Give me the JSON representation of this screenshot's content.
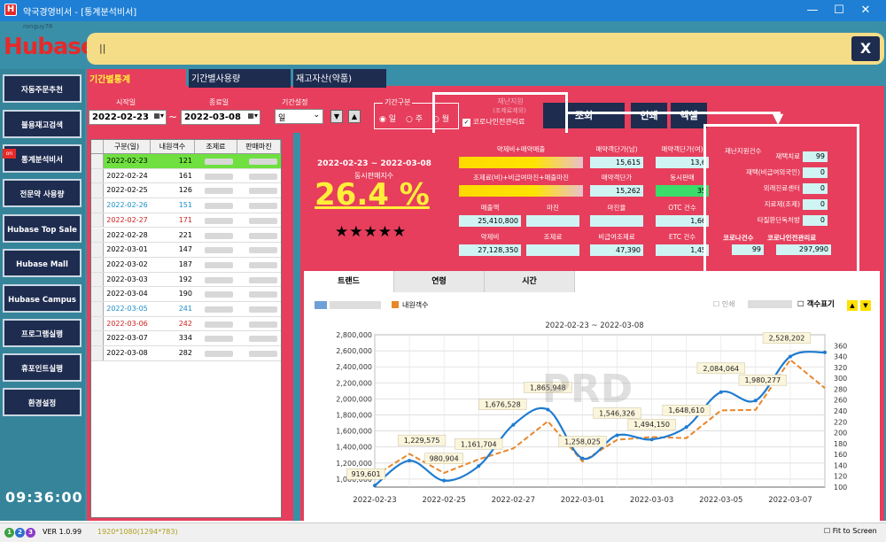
{
  "window": {
    "title": "약국경영비서 - [통계분석비서]",
    "icon_text": "H"
  },
  "logo": {
    "text": "Hubase",
    "small": "ronguy78"
  },
  "header": {
    "pause_icon": "||",
    "close_label": "X"
  },
  "sidebar": {
    "items": [
      "자동주문추천",
      "불용재고검색",
      "통계분석비서",
      "전문약 사용량",
      "Hubase Top Sale",
      "Hubase Mall",
      "Hubase Campus",
      "프로그램실행",
      "휴포인트실행",
      "환경설정"
    ],
    "on_badge": "on",
    "clock": "09:36:00"
  },
  "tabs": [
    "기간별통계",
    "기간별사용량",
    "재고자산(약품)"
  ],
  "filters": {
    "start_label": "시작일",
    "start_date": "2022-02-23",
    "end_label": "종료일",
    "end_date": "2022-03-08",
    "tilde": "~",
    "period_setting_label": "기간설정",
    "period_value": "일",
    "period_type_label": "기간구분",
    "radio_day": "일",
    "radio_week": "주",
    "radio_month": "월",
    "disaster_label": "재난지원",
    "disaster_sub": "(조제료제외)",
    "corona_label": "코로나인전관리료",
    "query_btn": "조회",
    "print_btn": "인쇄",
    "excel_btn": "엑셀"
  },
  "table": {
    "headers": [
      "구분(일)",
      "내원객수",
      "조제료",
      "판매마진"
    ],
    "rows": [
      {
        "date": "2022-02-23",
        "count": "121",
        "color": "#000",
        "highlight": true
      },
      {
        "date": "2022-02-24",
        "count": "161",
        "color": "#000"
      },
      {
        "date": "2022-02-25",
        "count": "126",
        "color": "#000"
      },
      {
        "date": "2022-02-26",
        "count": "151",
        "color": "#1e8fc8"
      },
      {
        "date": "2022-02-27",
        "count": "171",
        "color": "#d02020"
      },
      {
        "date": "2022-02-28",
        "count": "221",
        "color": "#000"
      },
      {
        "date": "2022-03-01",
        "count": "147",
        "color": "#000"
      },
      {
        "date": "2022-03-02",
        "count": "187",
        "color": "#000"
      },
      {
        "date": "2022-03-03",
        "count": "192",
        "color": "#000"
      },
      {
        "date": "2022-03-04",
        "count": "190",
        "color": "#000"
      },
      {
        "date": "2022-03-05",
        "count": "241",
        "color": "#1e8fc8"
      },
      {
        "date": "2022-03-06",
        "count": "242",
        "color": "#d02020"
      },
      {
        "date": "2022-03-07",
        "count": "334",
        "color": "#000"
      },
      {
        "date": "2022-03-08",
        "count": "282",
        "color": "#000"
      }
    ]
  },
  "summary": {
    "range": "2022-02-23 ~ 2022-03-08",
    "index_label": "동시판매지수",
    "index_value": "26.4 %",
    "stars": "★★★★★",
    "labels": {
      "drug_cost": "약제비+매약매출",
      "unit_male": "매약객단가(남)",
      "unit_female": "매약객단가(여)",
      "disp_fee": "조제료(비)+비급여마진+매출마진",
      "unit_price": "매약객단가",
      "simul_sale": "동시판매",
      "sales": "매출액",
      "margin": "마진",
      "margin_rate": "마진율",
      "otc_count": "OTC 건수",
      "drug_fee": "약제비",
      "disp": "조제료",
      "nonpay_fee": "비급여조제료",
      "etc_count": "ETC 건수"
    },
    "values": {
      "unit_male": "15,615",
      "unit_female": "13,6",
      "unit_price": "15,262",
      "simul_sale": "35",
      "sales": "25,410,800",
      "otc_count": "1,66",
      "drug_fee": "27,128,350",
      "nonpay_fee": "47,390",
      "etc_count": "1,45"
    }
  },
  "disaster_panel": {
    "title": "재난지원건수",
    "rows": [
      {
        "label": "재택치료",
        "value": "99"
      },
      {
        "label": "재택(비급여외국인)",
        "value": "0"
      },
      {
        "label": "외래진료센터",
        "value": "0"
      },
      {
        "label": "지료제(조제)",
        "value": "0"
      },
      {
        "label": "타질환단독처방",
        "value": "0"
      }
    ],
    "corona_count_label": "코로나건수",
    "corona_fee_label": "코로나인전관리료",
    "corona_count": "99",
    "corona_fee": "297,990"
  },
  "chart_tabs": [
    "트랜드",
    "연령",
    "시간"
  ],
  "chart_legend": {
    "series2": "내원객수",
    "print": "인쇄",
    "count_display": "객수표기",
    "watermark": "PRD"
  },
  "chart_data": {
    "type": "line",
    "title": "2022-02-23 ~ 2022-03-08",
    "x": [
      "2022-02-23",
      "2022-02-24",
      "2022-02-25",
      "2022-02-26",
      "2022-02-27",
      "2022-02-28",
      "2022-03-01",
      "2022-03-02",
      "2022-03-03",
      "2022-03-04",
      "2022-03-05",
      "2022-03-06",
      "2022-03-07",
      "2022-03-08"
    ],
    "xtick_labels": [
      "2022-02-23",
      "2022-02-25",
      "2022-02-27",
      "2022-03-01",
      "2022-03-03",
      "2022-03-05",
      "2022-03-07"
    ],
    "series": [
      {
        "values": [
          919601,
          1229575,
          980904,
          1161704,
          1676528,
          1865948,
          1258025,
          1546326,
          1494150,
          1648610,
          2084064,
          1980277,
          2528202,
          2580000
        ],
        "color": "#1e7bd0",
        "axis": "left"
      },
      {
        "name": "내원객수",
        "values": [
          121,
          161,
          126,
          151,
          171,
          221,
          147,
          187,
          192,
          190,
          241,
          242,
          334,
          282
        ],
        "color": "#e8872a",
        "axis": "right",
        "dashed": true
      }
    ],
    "data_labels": [
      "919,601",
      "1,229,575",
      "980,904",
      "1,161,704",
      "1,676,528",
      "1,865,948",
      "1,258,025",
      "1,546,326",
      "1,494,150",
      "1,648,610",
      "2,084,064",
      "1,980,277",
      "2,528,202"
    ],
    "ylim": [
      900000,
      2800000
    ],
    "yticks": [
      "1,000,000",
      "1,200,000",
      "1,400,000",
      "1,600,000",
      "1,800,000",
      "2,000,000",
      "2,200,000",
      "2,400,000",
      "2,600,000",
      "2,800,000"
    ],
    "y2lim": [
      100,
      380
    ],
    "y2ticks": [
      "100",
      "120",
      "140",
      "160",
      "180",
      "200",
      "220",
      "240",
      "260",
      "280",
      "300",
      "320",
      "340",
      "360"
    ],
    "grid": true
  },
  "status": {
    "version": "VER 1.0.99",
    "resolution": "1920*1080(1294*783)",
    "fit": "Fit to Screen"
  }
}
